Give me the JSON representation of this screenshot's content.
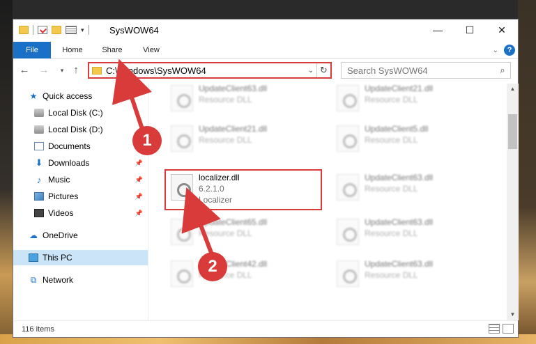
{
  "window": {
    "title": "SysWOW64"
  },
  "ribbon": {
    "tabs": [
      "File",
      "Home",
      "Share",
      "View"
    ]
  },
  "address": {
    "path": "C:\\Windows\\SysWOW64",
    "search_placeholder": "Search SysWOW64"
  },
  "sidebar": {
    "items": [
      {
        "label": "Quick access"
      },
      {
        "label": "Local Disk (C:)"
      },
      {
        "label": "Local Disk (D:)"
      },
      {
        "label": "Documents"
      },
      {
        "label": "Downloads"
      },
      {
        "label": "Music"
      },
      {
        "label": "Pictures"
      },
      {
        "label": "Videos"
      },
      {
        "label": "OneDrive"
      },
      {
        "label": "This PC"
      },
      {
        "label": "Network"
      }
    ]
  },
  "files": [
    {
      "name": "UpdateClient63.dll",
      "sub": "Resource DLL"
    },
    {
      "name": "UpdateClient21.dll",
      "sub": "Resource DLL"
    },
    {
      "name": "UpdateClient21.dll",
      "sub": "Resource DLL"
    },
    {
      "name": "UpdateClient5.dll",
      "sub": "Resource DLL"
    },
    {
      "name": "localizer.dll",
      "version": "6.2.1.0",
      "sub": "Localizer"
    },
    {
      "name": "UpdateClient63.dll",
      "sub": "Resource DLL"
    },
    {
      "name": "UpdateClient65.dll",
      "sub": "Resource DLL"
    },
    {
      "name": "UpdateClient63.dll",
      "sub": "Resource DLL"
    },
    {
      "name": "UpdateClient42.dll",
      "sub": "Resource DLL"
    },
    {
      "name": "UpdateClient63.dll",
      "sub": "Resource DLL"
    }
  ],
  "status": {
    "item_count": "116 items"
  },
  "annotations": {
    "step1": "1",
    "step2": "2"
  },
  "colors": {
    "accent": "#1a6fc7",
    "highlight": "#d93b3b"
  }
}
